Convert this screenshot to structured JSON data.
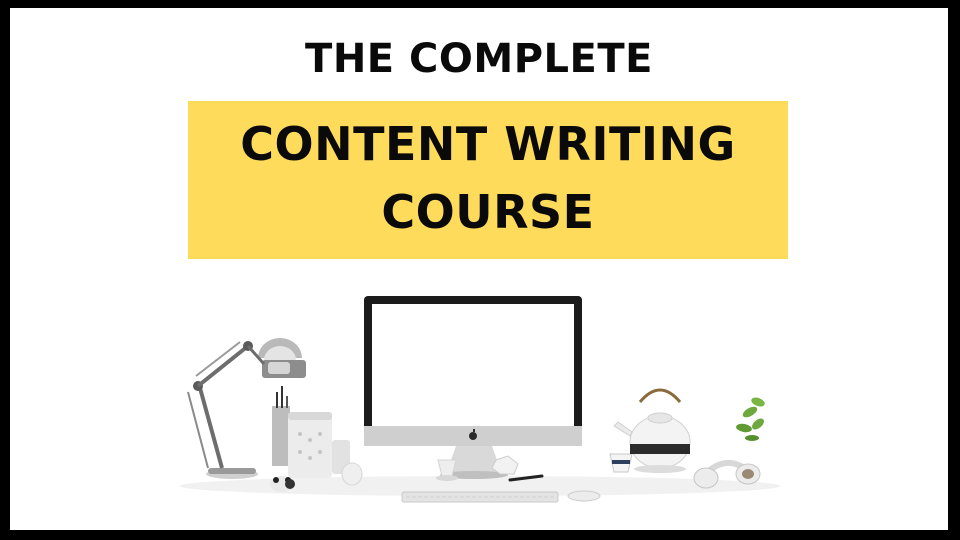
{
  "title": {
    "kicker": "THE COMPLETE",
    "line1": "CONTENT WRITING",
    "line2": "COURSE"
  },
  "colors": {
    "frame": "#000000",
    "background": "#ffffff",
    "banner": "#fedb5a",
    "text": "#0a0a0a"
  },
  "illustration": {
    "items": [
      "desk-lamp-icon",
      "pencil-cup-icon",
      "candle-holder-icon",
      "imac-monitor-icon",
      "apple-logo-icon",
      "keyboard-icon",
      "mouse-icon",
      "pen-icon",
      "teapot-icon",
      "teacup-icon",
      "headphones-icon",
      "plant-icon",
      "panda-figurine-icon",
      "crumpled-paper-icon"
    ]
  }
}
